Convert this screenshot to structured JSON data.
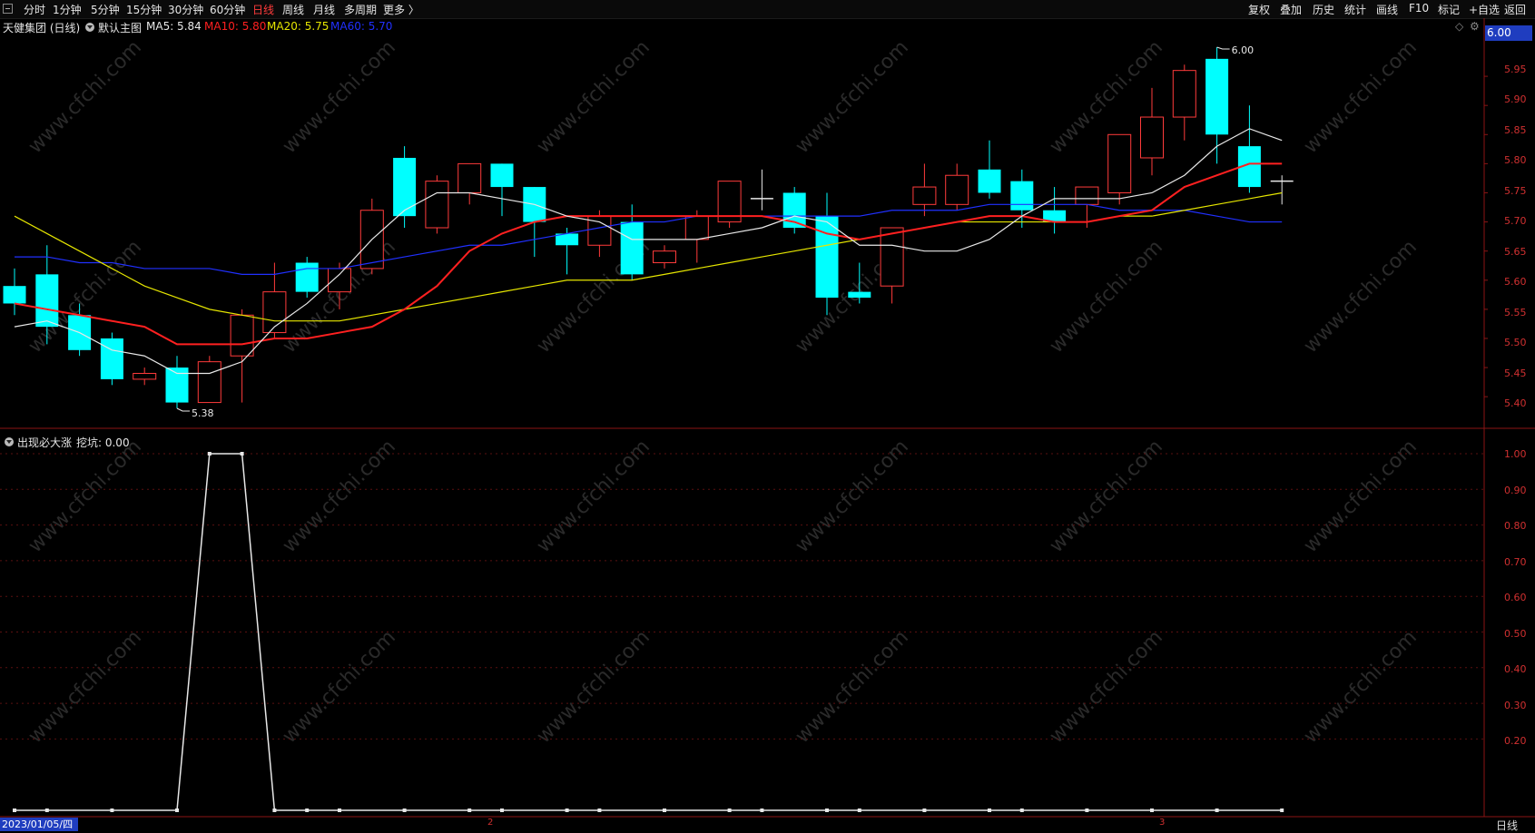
{
  "toolbar": {
    "items": [
      "分时",
      "1分钟",
      "5分钟",
      "15分钟",
      "30分钟",
      "60分钟",
      "日线",
      "周线",
      "月线",
      "多周期",
      "更多 〉"
    ],
    "active_index": 6,
    "right_items": [
      "复权",
      "叠加",
      "历史",
      "统计",
      "画线",
      "F10",
      "标记",
      "+自选",
      "返回"
    ]
  },
  "main_panel": {
    "stock_title": "天健集团 (日线)",
    "indicator_name": "默认主图",
    "ma5": "MA5: 5.84",
    "ma10": "MA10: 5.80",
    "ma20": "MA20: 5.75",
    "ma60": "MA60: 5.70",
    "price_badge": "6.00",
    "high_marker": "6.00",
    "low_marker": "5.38",
    "y_labels": [
      "5.95",
      "5.90",
      "5.85",
      "5.80",
      "5.75",
      "5.70",
      "5.65",
      "5.60",
      "5.55",
      "5.50",
      "5.45",
      "5.40"
    ]
  },
  "sub_panel": {
    "indicator_name": "出现必大涨",
    "value_label": "挖坑: 0.00",
    "y_labels": [
      "1.00",
      "0.90",
      "0.80",
      "0.70",
      "0.60",
      "0.50",
      "0.40",
      "0.30",
      "0.20"
    ]
  },
  "bottom": {
    "date_label": "2023/01/05/四",
    "month_ticks": [
      "2",
      "3"
    ],
    "period": "日线"
  },
  "watermark": "www.cfchi.com",
  "colors": {
    "up": "#ff3b3b",
    "down": "#00ffff",
    "ma5": "#e8e8e8",
    "ma10": "#ff2020",
    "ma20": "#e6e600",
    "ma60": "#2030ff",
    "badge": "#1f3dbf",
    "axis": "#8b1515"
  },
  "chart_data": {
    "type": "candlestick",
    "candles": [
      {
        "o": 5.59,
        "c": 5.56,
        "h": 5.62,
        "l": 5.54
      },
      {
        "o": 5.61,
        "c": 5.52,
        "h": 5.66,
        "l": 5.49
      },
      {
        "o": 5.54,
        "c": 5.48,
        "h": 5.56,
        "l": 5.47
      },
      {
        "o": 5.5,
        "c": 5.43,
        "h": 5.51,
        "l": 5.42
      },
      {
        "o": 5.43,
        "c": 5.44,
        "h": 5.45,
        "l": 5.42
      },
      {
        "o": 5.45,
        "c": 5.39,
        "h": 5.47,
        "l": 5.38
      },
      {
        "o": 5.39,
        "c": 5.46,
        "h": 5.47,
        "l": 5.39
      },
      {
        "o": 5.47,
        "c": 5.54,
        "h": 5.55,
        "l": 5.39
      },
      {
        "o": 5.51,
        "c": 5.58,
        "h": 5.63,
        "l": 5.5
      },
      {
        "o": 5.63,
        "c": 5.58,
        "h": 5.64,
        "l": 5.57
      },
      {
        "o": 5.58,
        "c": 5.62,
        "h": 5.63,
        "l": 5.55
      },
      {
        "o": 5.62,
        "c": 5.72,
        "h": 5.74,
        "l": 5.61
      },
      {
        "o": 5.81,
        "c": 5.71,
        "h": 5.83,
        "l": 5.69
      },
      {
        "o": 5.69,
        "c": 5.77,
        "h": 5.78,
        "l": 5.68
      },
      {
        "o": 5.75,
        "c": 5.8,
        "h": 5.8,
        "l": 5.73
      },
      {
        "o": 5.8,
        "c": 5.76,
        "h": 5.8,
        "l": 5.71
      },
      {
        "o": 5.76,
        "c": 5.7,
        "h": 5.76,
        "l": 5.64
      },
      {
        "o": 5.68,
        "c": 5.66,
        "h": 5.69,
        "l": 5.61
      },
      {
        "o": 5.66,
        "c": 5.71,
        "h": 5.72,
        "l": 5.64
      },
      {
        "o": 5.7,
        "c": 5.61,
        "h": 5.73,
        "l": 5.6
      },
      {
        "o": 5.63,
        "c": 5.65,
        "h": 5.66,
        "l": 5.62
      },
      {
        "o": 5.67,
        "c": 5.71,
        "h": 5.72,
        "l": 5.63
      },
      {
        "o": 5.7,
        "c": 5.77,
        "h": 5.77,
        "l": 5.69
      },
      {
        "o": 5.74,
        "c": 5.74,
        "h": 5.79,
        "l": 5.72
      },
      {
        "o": 5.75,
        "c": 5.69,
        "h": 5.76,
        "l": 5.68
      },
      {
        "o": 5.71,
        "c": 5.57,
        "h": 5.75,
        "l": 5.54
      },
      {
        "o": 5.58,
        "c": 5.57,
        "h": 5.63,
        "l": 5.56
      },
      {
        "o": 5.59,
        "c": 5.69,
        "h": 5.69,
        "l": 5.56
      },
      {
        "o": 5.73,
        "c": 5.76,
        "h": 5.8,
        "l": 5.71
      },
      {
        "o": 5.73,
        "c": 5.78,
        "h": 5.8,
        "l": 5.72
      },
      {
        "o": 5.79,
        "c": 5.75,
        "h": 5.84,
        "l": 5.74
      },
      {
        "o": 5.77,
        "c": 5.72,
        "h": 5.79,
        "l": 5.69
      },
      {
        "o": 5.72,
        "c": 5.7,
        "h": 5.76,
        "l": 5.68
      },
      {
        "o": 5.73,
        "c": 5.76,
        "h": 5.76,
        "l": 5.69
      },
      {
        "o": 5.75,
        "c": 5.85,
        "h": 5.85,
        "l": 5.73
      },
      {
        "o": 5.81,
        "c": 5.88,
        "h": 5.93,
        "l": 5.78
      },
      {
        "o": 5.88,
        "c": 5.96,
        "h": 5.97,
        "l": 5.84
      },
      {
        "o": 5.98,
        "c": 5.85,
        "h": 6.0,
        "l": 5.8
      },
      {
        "o": 5.83,
        "c": 5.76,
        "h": 5.9,
        "l": 5.75
      },
      {
        "o": 5.77,
        "c": 5.77,
        "h": 5.78,
        "l": 5.73
      }
    ],
    "ma5": [
      5.52,
      5.53,
      5.51,
      5.48,
      5.47,
      5.44,
      5.44,
      5.46,
      5.52,
      5.56,
      5.61,
      5.67,
      5.72,
      5.75,
      5.75,
      5.74,
      5.73,
      5.71,
      5.7,
      5.67,
      5.67,
      5.67,
      5.68,
      5.69,
      5.71,
      5.7,
      5.66,
      5.66,
      5.65,
      5.65,
      5.67,
      5.71,
      5.74,
      5.74,
      5.74,
      5.75,
      5.78,
      5.83,
      5.86,
      5.84
    ],
    "ma10": [
      5.56,
      5.55,
      5.54,
      5.53,
      5.52,
      5.49,
      5.49,
      5.49,
      5.5,
      5.5,
      5.51,
      5.52,
      5.55,
      5.59,
      5.65,
      5.68,
      5.7,
      5.71,
      5.71,
      5.71,
      5.71,
      5.71,
      5.71,
      5.71,
      5.7,
      5.68,
      5.67,
      5.68,
      5.69,
      5.7,
      5.71,
      5.71,
      5.7,
      5.7,
      5.71,
      5.72,
      5.76,
      5.78,
      5.8,
      5.8
    ],
    "ma20": [
      5.71,
      5.68,
      5.65,
      5.62,
      5.59,
      5.57,
      5.55,
      5.54,
      5.53,
      5.53,
      5.53,
      5.54,
      5.55,
      5.56,
      5.57,
      5.58,
      5.59,
      5.6,
      5.6,
      5.6,
      5.61,
      5.62,
      5.63,
      5.64,
      5.65,
      5.66,
      5.67,
      5.68,
      5.69,
      5.7,
      5.7,
      5.7,
      5.7,
      5.7,
      5.71,
      5.71,
      5.72,
      5.73,
      5.74,
      5.75
    ],
    "ma60": [
      5.64,
      5.64,
      5.63,
      5.63,
      5.62,
      5.62,
      5.62,
      5.61,
      5.61,
      5.62,
      5.62,
      5.63,
      5.64,
      5.65,
      5.66,
      5.66,
      5.67,
      5.68,
      5.69,
      5.7,
      5.7,
      5.71,
      5.71,
      5.71,
      5.71,
      5.71,
      5.71,
      5.72,
      5.72,
      5.72,
      5.73,
      5.73,
      5.73,
      5.73,
      5.72,
      5.72,
      5.72,
      5.71,
      5.7,
      5.7
    ],
    "signal": [
      0,
      0,
      null,
      0,
      null,
      0,
      1,
      1,
      0,
      0,
      0,
      null,
      0,
      null,
      0,
      0,
      null,
      0,
      0,
      null,
      0,
      null,
      0,
      0,
      null,
      0,
      0,
      null,
      0,
      null,
      0,
      0,
      null,
      0,
      null,
      0,
      null,
      0,
      null,
      0
    ],
    "ylim_main": [
      5.38,
      6.0
    ],
    "ylim_sub": [
      0,
      1.0
    ]
  }
}
